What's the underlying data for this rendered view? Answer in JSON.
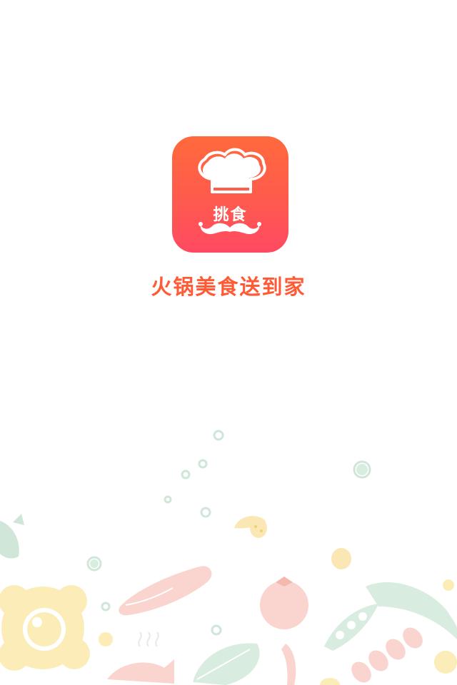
{
  "app": {
    "icon_text": "挑食",
    "icon_name": "chef-hat-mustache-icon",
    "slogan": "火锅美食送到家"
  },
  "colors": {
    "icon_gradient_top": "#ff6a3c",
    "icon_gradient_bottom": "#ff4a62",
    "slogan": "#ff5a36",
    "background": "#ffffff"
  },
  "decor": {
    "icon_name": "vegetable-pattern-illustration"
  }
}
